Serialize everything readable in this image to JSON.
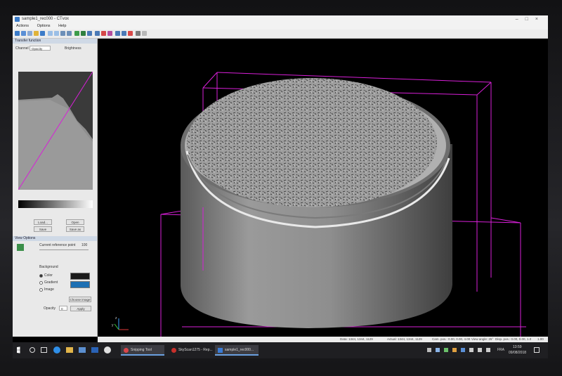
{
  "window": {
    "title": "sample1_rec000 - CTvox",
    "menus": [
      "Actions",
      "Options",
      "Help"
    ]
  },
  "left_panel": {
    "transfer_header": "Transfer function",
    "channel_label": "Channel",
    "channel_value": "Opacity",
    "brightness_label": "Brightness",
    "load_button": "Load...",
    "open_button": "Open",
    "save_button": "Save",
    "save_as_button": "Save as",
    "view_options_header": "View Options",
    "clipping_label": "Current reference point",
    "clipping_value": "100",
    "background_label": "Background",
    "bg_options": [
      "Color",
      "Gradient",
      "Image"
    ],
    "choose_image_button": "Choose image",
    "opacity_label": "Opacity",
    "opacity_value": "0",
    "apply_button": "Apply",
    "colors": {
      "swatch_top": "#1a1a1a",
      "swatch_bottom": "#1d6fb3"
    }
  },
  "viewport": {
    "bbox_color": "#d81fd8",
    "axis_labels": {
      "y": "y",
      "z": "z"
    }
  },
  "status_bar": {
    "size": "Data: 1344, 1344, 1129",
    "actual": "Actual: 1344, 1344, 1129",
    "cam": "Cam. pos.: 0.00, 0.00, 4.00",
    "view_angle": "View angle: 25°",
    "fps": "Disp. pos.: 0.00, 0.00, 1.0",
    "zoom": "1.00"
  },
  "taskbar": {
    "items": [
      {
        "label": "Snipping Tool",
        "color": "#d9464b"
      },
      {
        "label": "SkyScan1275 - Rep...",
        "color": "#c8302b"
      },
      {
        "label": "sample1_rec000...",
        "color": "#3a7bd5"
      }
    ],
    "lang": "FRA",
    "time": "13:59",
    "date": "09/08/2018"
  }
}
